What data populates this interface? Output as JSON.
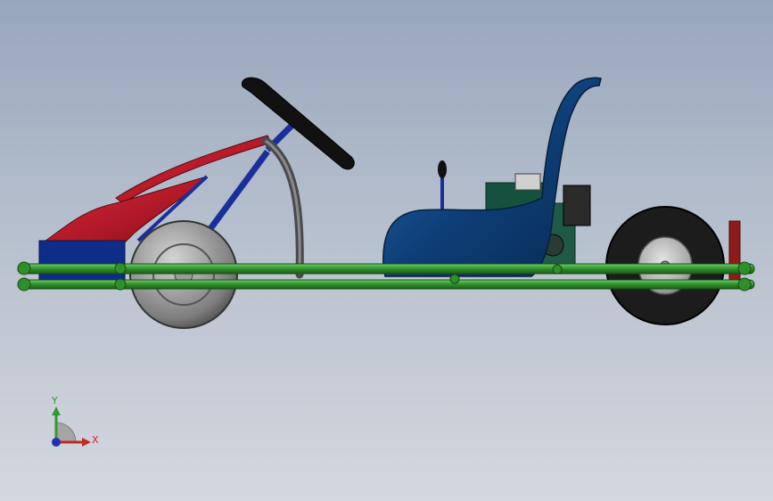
{
  "axis_triad": {
    "x_label": "X",
    "y_label": "Y",
    "x_color": "#c62828",
    "y_color": "#2e9b2e",
    "z_color": "#2233aa"
  },
  "colors": {
    "frame_tube": "#2f8f2a",
    "frame_tube_highlight": "#5fc25a",
    "body_blue": "#0e3f78",
    "seat_blue": "#103e73",
    "nose_red": "#c0152a",
    "tire": "#1e1e1e",
    "rim": "#bdbdbd",
    "steering_wheel": "#111111",
    "steering_column": "#1a2f9a"
  },
  "icons": {
    "axis_triad": "xyz-triad-icon",
    "model": "go-kart-model-icon"
  }
}
